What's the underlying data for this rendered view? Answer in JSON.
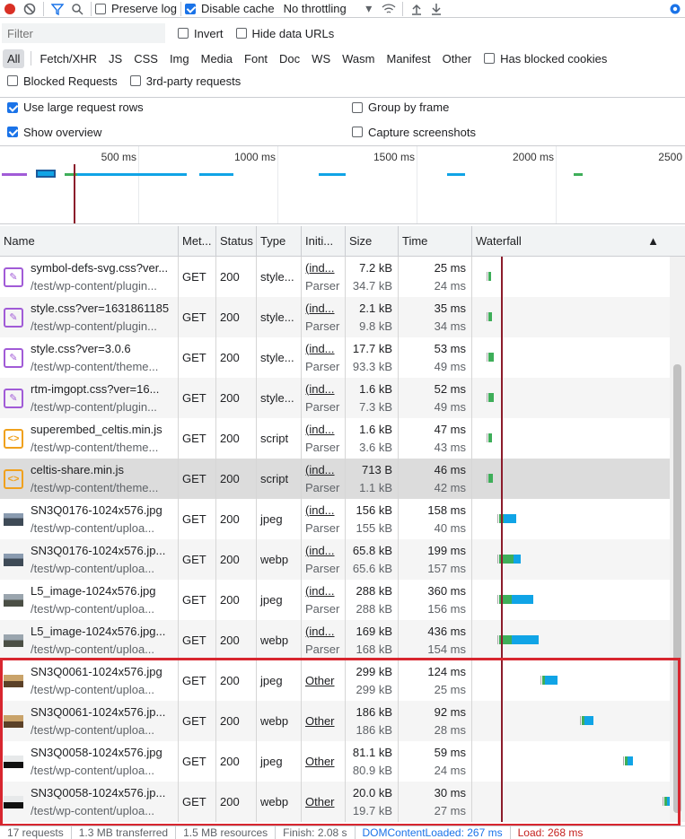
{
  "toolbar": {
    "preserve_log": "Preserve log",
    "disable_cache": "Disable cache",
    "throttling": "No throttling"
  },
  "filter": {
    "placeholder": "Filter",
    "invert": "Invert",
    "hide_data_urls": "Hide data URLs"
  },
  "types": [
    "All",
    "Fetch/XHR",
    "JS",
    "CSS",
    "Img",
    "Media",
    "Font",
    "Doc",
    "WS",
    "Wasm",
    "Manifest",
    "Other"
  ],
  "has_blocked_cookies": "Has blocked cookies",
  "blocked_requests": "Blocked Requests",
  "third_party": "3rd-party requests",
  "options": {
    "large_rows": "Use large request rows",
    "group_by_frame": "Group by frame",
    "show_overview": "Show overview",
    "capture_screenshots": "Capture screenshots"
  },
  "overview_labels": [
    "500 ms",
    "1000 ms",
    "1500 ms",
    "2000 ms",
    "2500"
  ],
  "columns": {
    "name": "Name",
    "method": "Met...",
    "status": "Status",
    "type": "Type",
    "initiator": "Initi...",
    "size": "Size",
    "time": "Time",
    "waterfall": "Waterfall"
  },
  "rows": [
    {
      "name": "symbol-defs-svg.css?ver...",
      "path": "/test/wp-content/plugin...",
      "icon": "css",
      "method": "GET",
      "status": "200",
      "type": "style...",
      "init": "(ind...",
      "init2": "Parser",
      "size": "7.2 kB",
      "size2": "34.7 kB",
      "time": "25 ms",
      "time2": "24 ms"
    },
    {
      "name": "style.css?ver=1631861185",
      "path": "/test/wp-content/plugin...",
      "icon": "css",
      "method": "GET",
      "status": "200",
      "type": "style...",
      "init": "(ind...",
      "init2": "Parser",
      "size": "2.1 kB",
      "size2": "9.8 kB",
      "time": "35 ms",
      "time2": "34 ms"
    },
    {
      "name": "style.css?ver=3.0.6",
      "path": "/test/wp-content/theme...",
      "icon": "css",
      "method": "GET",
      "status": "200",
      "type": "style...",
      "init": "(ind...",
      "init2": "Parser",
      "size": "17.7 kB",
      "size2": "93.3 kB",
      "time": "53 ms",
      "time2": "49 ms"
    },
    {
      "name": "rtm-imgopt.css?ver=16...",
      "path": "/test/wp-content/plugin...",
      "icon": "css",
      "method": "GET",
      "status": "200",
      "type": "style...",
      "init": "(ind...",
      "init2": "Parser",
      "size": "1.6 kB",
      "size2": "7.3 kB",
      "time": "52 ms",
      "time2": "49 ms"
    },
    {
      "name": "superembed_celtis.min.js",
      "path": "/test/wp-content/theme...",
      "icon": "js",
      "method": "GET",
      "status": "200",
      "type": "script",
      "init": "(ind...",
      "init2": "Parser",
      "size": "1.6 kB",
      "size2": "3.6 kB",
      "time": "47 ms",
      "time2": "43 ms"
    },
    {
      "name": "celtis-share.min.js",
      "path": "/test/wp-content/theme...",
      "icon": "js",
      "method": "GET",
      "status": "200",
      "type": "script",
      "init": "(ind...",
      "init2": "Parser",
      "size": "713 B",
      "size2": "1.1 kB",
      "time": "46 ms",
      "time2": "42 ms"
    },
    {
      "name": "SN3Q0176-1024x576.jpg",
      "path": "/test/wp-content/uploa...",
      "icon": "img-a",
      "method": "GET",
      "status": "200",
      "type": "jpeg",
      "init": "(ind...",
      "init2": "Parser",
      "size": "156 kB",
      "size2": "155 kB",
      "time": "158 ms",
      "time2": "40 ms"
    },
    {
      "name": "SN3Q0176-1024x576.jp...",
      "path": "/test/wp-content/uploa...",
      "icon": "img-a",
      "method": "GET",
      "status": "200",
      "type": "webp",
      "init": "(ind...",
      "init2": "Parser",
      "size": "65.8 kB",
      "size2": "65.6 kB",
      "time": "199 ms",
      "time2": "157 ms"
    },
    {
      "name": "L5_image-1024x576.jpg",
      "path": "/test/wp-content/uploa...",
      "icon": "img-b",
      "method": "GET",
      "status": "200",
      "type": "jpeg",
      "init": "(ind...",
      "init2": "Parser",
      "size": "288 kB",
      "size2": "288 kB",
      "time": "360 ms",
      "time2": "156 ms"
    },
    {
      "name": "L5_image-1024x576.jpg...",
      "path": "/test/wp-content/uploa...",
      "icon": "img-b",
      "method": "GET",
      "status": "200",
      "type": "webp",
      "init": "(ind...",
      "init2": "Parser",
      "size": "169 kB",
      "size2": "168 kB",
      "time": "436 ms",
      "time2": "154 ms"
    },
    {
      "name": "SN3Q0061-1024x576.jpg",
      "path": "/test/wp-content/uploa...",
      "icon": "img-c",
      "method": "GET",
      "status": "200",
      "type": "jpeg",
      "init": "Other",
      "init2": "",
      "size": "299 kB",
      "size2": "299 kB",
      "time": "124 ms",
      "time2": "25 ms"
    },
    {
      "name": "SN3Q0061-1024x576.jp...",
      "path": "/test/wp-content/uploa...",
      "icon": "img-c",
      "method": "GET",
      "status": "200",
      "type": "webp",
      "init": "Other",
      "init2": "",
      "size": "186 kB",
      "size2": "186 kB",
      "time": "92 ms",
      "time2": "28 ms"
    },
    {
      "name": "SN3Q0058-1024x576.jpg",
      "path": "/test/wp-content/uploa...",
      "icon": "img-d",
      "method": "GET",
      "status": "200",
      "type": "jpeg",
      "init": "Other",
      "init2": "",
      "size": "81.1 kB",
      "size2": "80.9 kB",
      "time": "59 ms",
      "time2": "24 ms"
    },
    {
      "name": "SN3Q0058-1024x576.jp...",
      "path": "/test/wp-content/uploa...",
      "icon": "img-d",
      "method": "GET",
      "status": "200",
      "type": "webp",
      "init": "Other",
      "init2": "",
      "size": "20.0 kB",
      "size2": "19.7 kB",
      "time": "30 ms",
      "time2": "27 ms"
    }
  ],
  "status_bar": {
    "requests": "17 requests",
    "transferred": "1.3 MB transferred",
    "resources": "1.5 MB resources",
    "finish": "Finish: 2.08 s",
    "dcl": "DOMContentLoaded: 267 ms",
    "load": "Load: 268 ms"
  },
  "colors": {
    "accent": "#1a73e8",
    "record": "#d93025",
    "load_line": "#8b1c2b",
    "highlight_border": "#d8262f"
  }
}
